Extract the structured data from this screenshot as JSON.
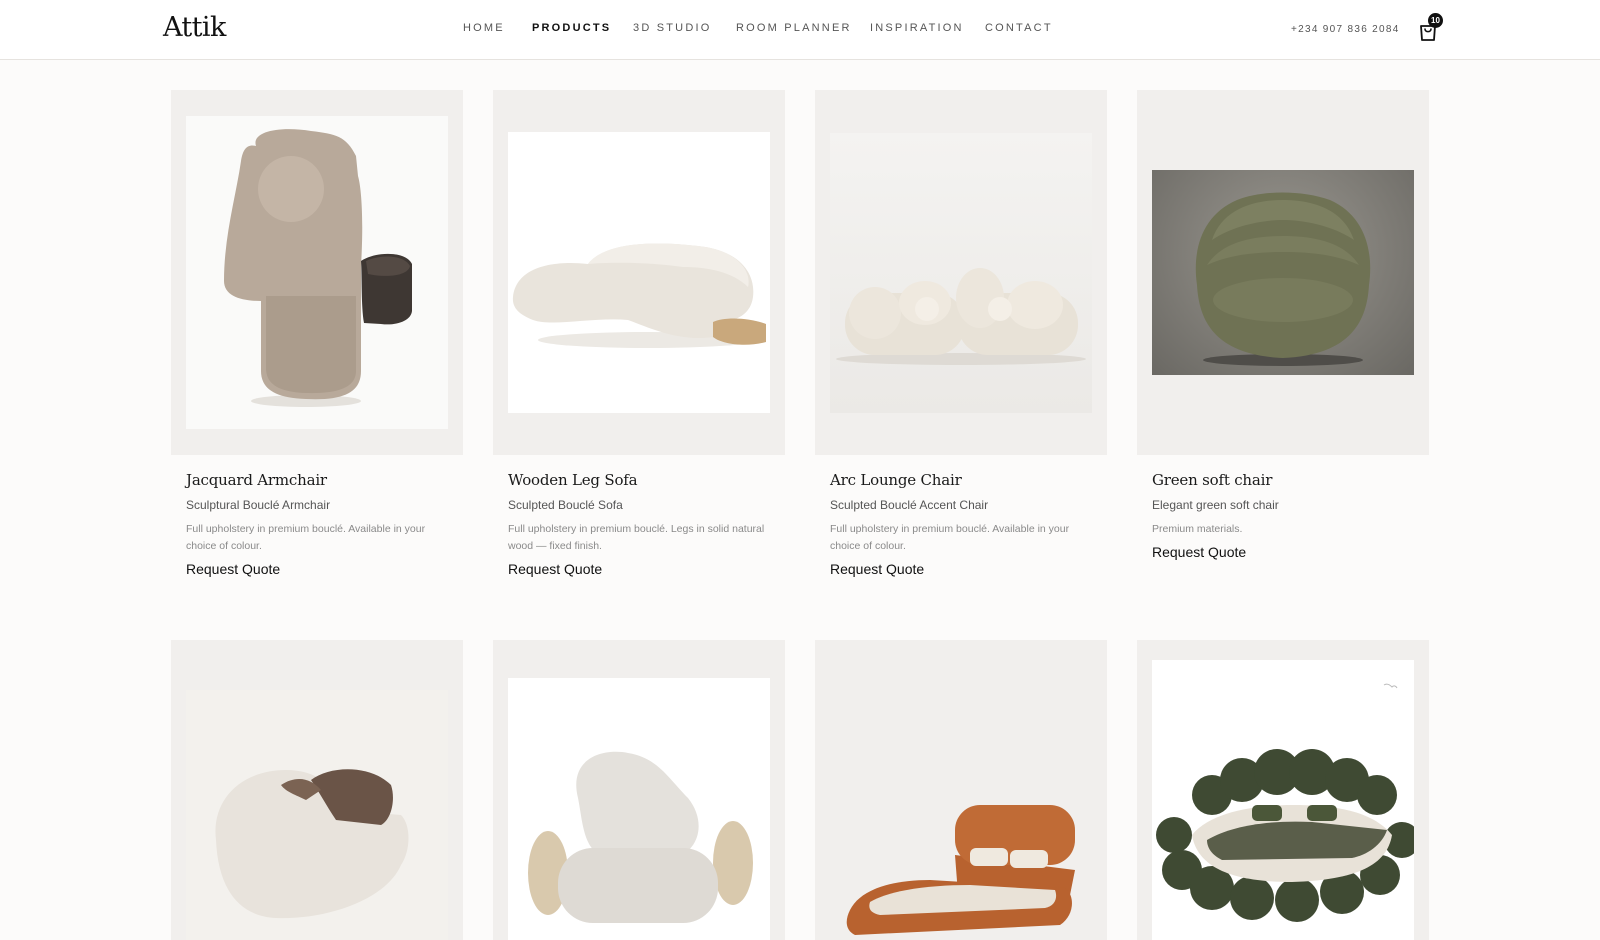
{
  "header": {
    "logo": "Attik",
    "nav": [
      "HOME",
      "PRODUCTS",
      "3D STUDIO",
      "ROOM PLANNER",
      "INSPIRATION",
      "CONTACT"
    ],
    "active_nav": "PRODUCTS",
    "phone": "+234 907 836 2084",
    "cart_count": "10"
  },
  "products": [
    {
      "name": "Jacquard Armchair",
      "subtitle": "Sculptural Bouclé Armchair",
      "description": "Full upholstery in premium bouclé. Available in your choice of colour.",
      "cta": "Request Quote"
    },
    {
      "name": "Wooden Leg Sofa",
      "subtitle": "Sculpted Bouclé Sofa",
      "description": "Full upholstery in premium bouclé. Legs in solid natural wood — fixed finish.",
      "cta": "Request Quote"
    },
    {
      "name": "Arc Lounge Chair",
      "subtitle": "Sculpted Bouclé Accent Chair",
      "description": "Full upholstery in premium bouclé. Available in your choice of colour.",
      "cta": "Request Quote"
    },
    {
      "name": "Green soft chair",
      "subtitle": "Elegant green soft chair",
      "description": "Premium materials.",
      "cta": "Request Quote"
    }
  ],
  "colors": {
    "page_bg": "#fcfbfa",
    "card_bg": "#f1efed",
    "text_primary": "#111111",
    "text_muted": "#8a8a8a"
  },
  "icons": {
    "cart": "shopping-bag-icon"
  }
}
